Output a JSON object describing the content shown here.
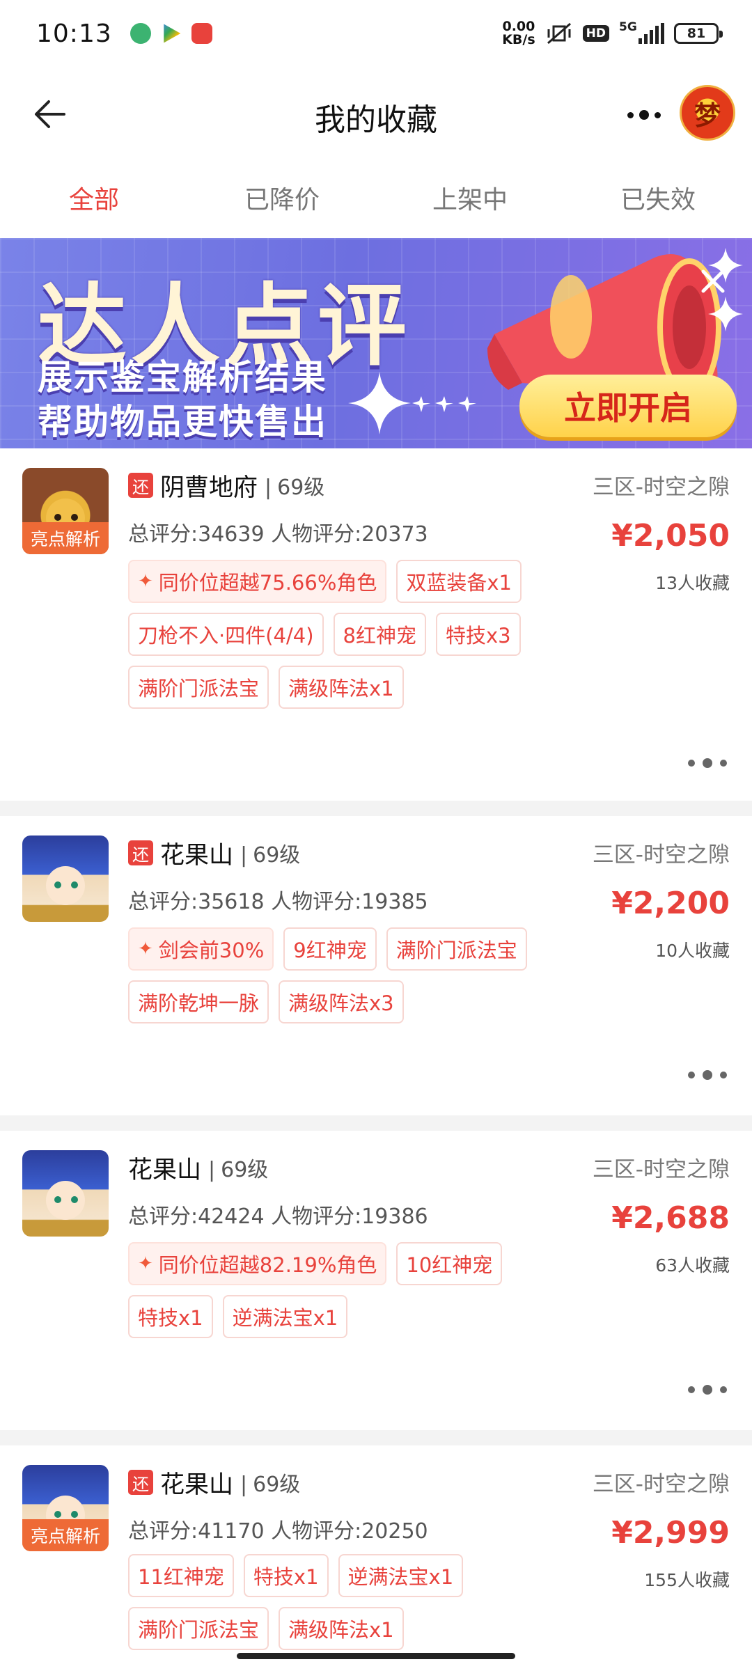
{
  "status_bar": {
    "time": "10:13",
    "net_speed_value": "0.00",
    "net_speed_unit": "KB/s",
    "hd": "HD",
    "network": "5G",
    "battery": "81"
  },
  "header": {
    "title": "我的收藏",
    "avatar_char": "梦"
  },
  "tabs": [
    "全部",
    "已降价",
    "上架中",
    "已失效"
  ],
  "banner": {
    "title": "达人点评",
    "line1": "展示鉴宝解析结果",
    "line2": "帮助物品更快售出",
    "cta": "立即开启"
  },
  "items": [
    {
      "huan": "还",
      "name": "阴曹地府",
      "level": "69级",
      "server": "三区-时空之隙",
      "scores": "总评分:34639 人物评分:20373",
      "price": "¥2,050",
      "favs": "13人收藏",
      "badge": "亮点解析",
      "tags": [
        "同价位超越75.66%角色",
        "双蓝装备x1",
        "刀枪不入·四件(4/4)",
        "8红神宠",
        "特技x3",
        "满阶门派法宝",
        "满级阵法x1"
      ]
    },
    {
      "huan": "还",
      "name": "花果山",
      "level": "69级",
      "server": "三区-时空之隙",
      "scores": "总评分:35618 人物评分:19385",
      "price": "¥2,200",
      "favs": "10人收藏",
      "tags": [
        "剑会前30%",
        "9红神宠",
        "满阶门派法宝",
        "满阶乾坤一脉",
        "满级阵法x3"
      ]
    },
    {
      "name": "花果山",
      "level": "69级",
      "server": "三区-时空之隙",
      "scores": "总评分:42424 人物评分:19386",
      "price": "¥2,688",
      "favs": "63人收藏",
      "tags": [
        "同价位超越82.19%角色",
        "10红神宠",
        "特技x1",
        "逆满法宝x1"
      ]
    },
    {
      "huan": "还",
      "name": "花果山",
      "level": "69级",
      "server": "三区-时空之隙",
      "scores": "总评分:41170 人物评分:20250",
      "price": "¥2,999",
      "favs": "155人收藏",
      "badge": "亮点解析",
      "tags": [
        "11红神宠",
        "特技x1",
        "逆满法宝x1",
        "满阶门派法宝",
        "满级阵法x1"
      ]
    }
  ],
  "colors": {
    "accent": "#e8423c",
    "badge": "#ee6a36",
    "banner_bg": "#7a83e8",
    "cta_bg": "#ffd24a"
  }
}
